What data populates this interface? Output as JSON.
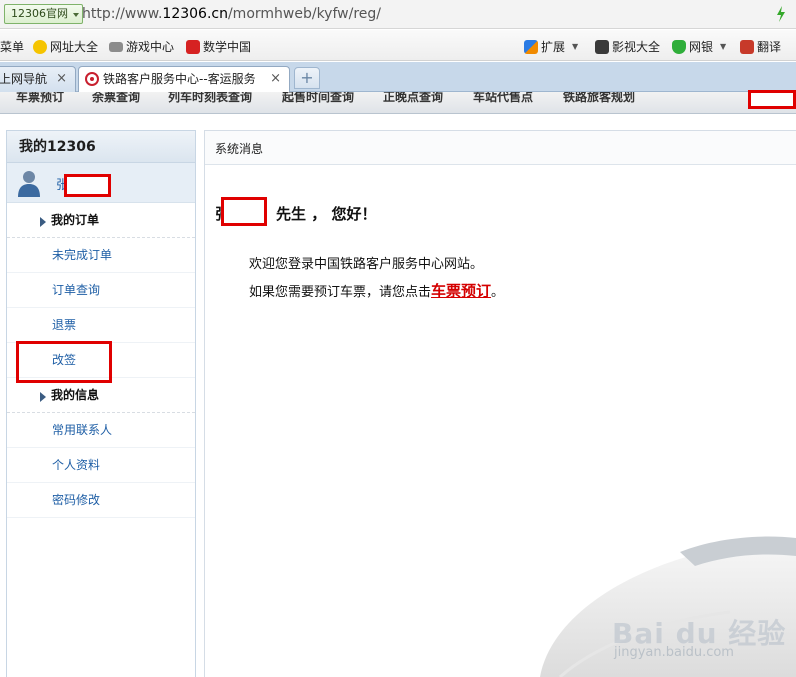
{
  "browser": {
    "site_button": "12306官网",
    "url_prefix": "http://www.",
    "url_host": "12306.cn",
    "url_path": "/mormhweb/kyfw/reg/"
  },
  "favorites": {
    "menu": "菜单",
    "items": [
      "网址大全",
      "游戏中心",
      "数学中国"
    ],
    "right_items": [
      "扩展",
      "影视大全",
      "网银",
      "翻译"
    ]
  },
  "tabs": [
    {
      "label": "上网导航",
      "active": false
    },
    {
      "label": "铁路客户服务中心--客运服务",
      "active": true
    }
  ],
  "site_nav": {
    "items": [
      "车票预订",
      "余票查询",
      "列车时刻表查询",
      "起售时间查询",
      "正晚点查询",
      "车站代售点",
      "铁路旅客规划"
    ]
  },
  "left_panel": {
    "title": "我的12306",
    "user_name_prefix": "张",
    "sections": [
      {
        "label": "我的订单",
        "items": [
          "未完成订单",
          "订单查询",
          "退票",
          "改签"
        ]
      },
      {
        "label": "我的信息",
        "items": [
          "常用联系人",
          "个人资料",
          "密码修改"
        ]
      }
    ]
  },
  "main": {
    "header": "系统消息",
    "greeting_prefix": "张",
    "greeting_suffix": "先生 ， 您好！",
    "message_1": "欢迎您登录中国铁路客户服务中心网站。",
    "message_2_prefix": "如果您需要预订车票，请您点击",
    "message_2_link": "车票预订",
    "message_2_suffix": "。"
  },
  "watermark": {
    "brand": "Bai du 经验",
    "site": "jingyan.baidu.com"
  },
  "colors": {
    "link_blue": "#1f5fa6",
    "highlight_red": "#e00000",
    "booking_link_red": "#d40000"
  }
}
